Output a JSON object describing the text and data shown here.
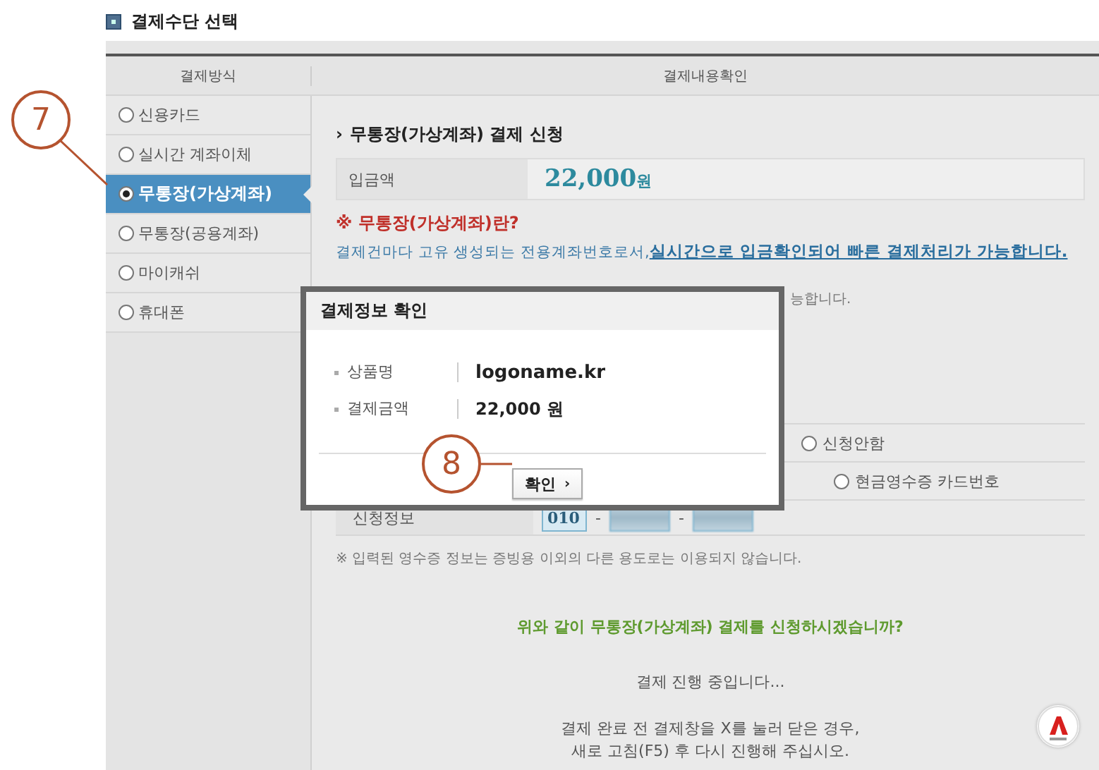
{
  "section_title": "결제수단 선택",
  "table": {
    "columns": [
      "결제방식",
      "결제내용확인"
    ]
  },
  "methods": [
    {
      "label": "신용카드",
      "selected": false
    },
    {
      "label": "실시간 계좌이체",
      "selected": false
    },
    {
      "label": "무통장(가상계좌)",
      "selected": true
    },
    {
      "label": "무통장(공용계좌)",
      "selected": false
    },
    {
      "label": "마이캐쉬",
      "selected": false
    },
    {
      "label": "휴대폰",
      "selected": false
    }
  ],
  "content": {
    "title": "무통장(가상계좌) 결제 신청",
    "title_icon": "›",
    "amount": {
      "label": "입금액",
      "value": "22,000",
      "unit": "원"
    },
    "info_title": "※ 무통장(가상계좌)란?",
    "info_text": "결제건마다 고유 생성되는 전용계좌번호로서,",
    "info_link": "실시간으로 입금확인되어 빠른 결제처리가 가능합니다.",
    "partial_text": "능합니다.",
    "receipt_options": [
      {
        "label": "신청안함",
        "checked": false
      },
      {
        "label": "현금영수증 카드번호",
        "checked": false
      }
    ],
    "apply_info": {
      "label": "신청정보",
      "fields": [
        {
          "kind": "text",
          "value": "010"
        },
        {
          "kind": "redacted"
        },
        {
          "kind": "redacted"
        }
      ],
      "separators": [
        "-",
        "-"
      ]
    },
    "notice": "※ 입력된 영수증 정보는 증빙용 이외의 다른 용도로는 이용되지 않습니다.",
    "question": "위와 같이 무통장(가상계좌) 결제를 신청하시겠습니까?",
    "status": "결제 진행 중입니다...",
    "instructions": [
      "결제 완료 전 결제창을 X를 눌러 닫은 경우,",
      "새로 고침(F5) 후 다시 진행해 주십시오."
    ]
  },
  "dialog": {
    "title": "결제정보 확인",
    "rows": [
      {
        "label": "상품명",
        "value": "logoname.kr"
      },
      {
        "label": "결제금액",
        "value": "22,000 원"
      }
    ],
    "button": {
      "label": "확인",
      "icon": "›"
    }
  },
  "callouts": [
    {
      "number": "7"
    },
    {
      "number": "8"
    }
  ]
}
